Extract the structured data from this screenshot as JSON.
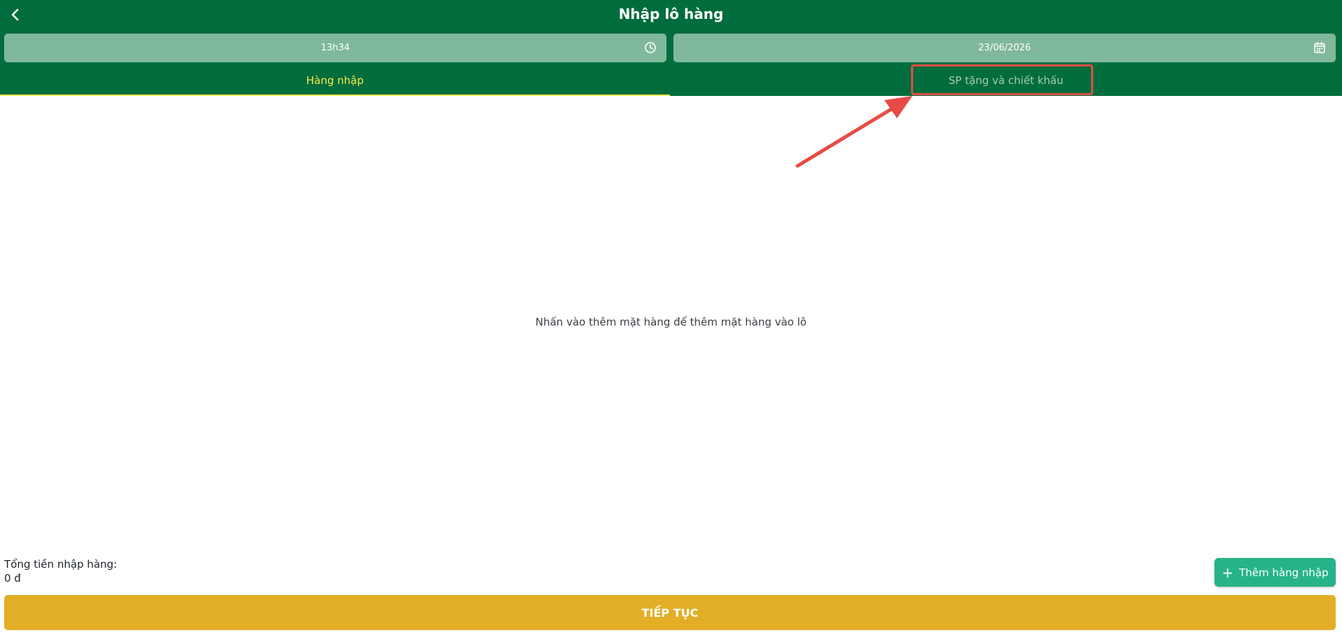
{
  "header": {
    "title": "Nhập lô hàng",
    "back_icon": "chevron-left-icon",
    "time_value": "13h34",
    "time_icon": "clock-icon",
    "date_value": "23/06/2026",
    "date_icon": "calendar-icon"
  },
  "tabs": [
    {
      "label": "Hàng nhập",
      "active": true
    },
    {
      "label": "SP tặng và chiết khấu",
      "active": false
    }
  ],
  "main": {
    "empty_message": "Nhấn vào thêm mặt hàng để thêm mặt hàng vào lô"
  },
  "footer": {
    "total_label": "Tổng tiền nhập hàng:",
    "total_value": "0 đ",
    "add_button_label": "Thêm hàng nhập",
    "add_button_icon": "plus-icon",
    "continue_label": "TIẾP TỤC"
  },
  "colors": {
    "header_bg": "#026d3c",
    "field_bg": "#80b89c",
    "active_tab": "#f6e850",
    "inactive_tab": "#a4ccb6",
    "add_button": "#27b38a",
    "continue_button": "#e2ae27",
    "annotation_red": "#e74b45"
  }
}
